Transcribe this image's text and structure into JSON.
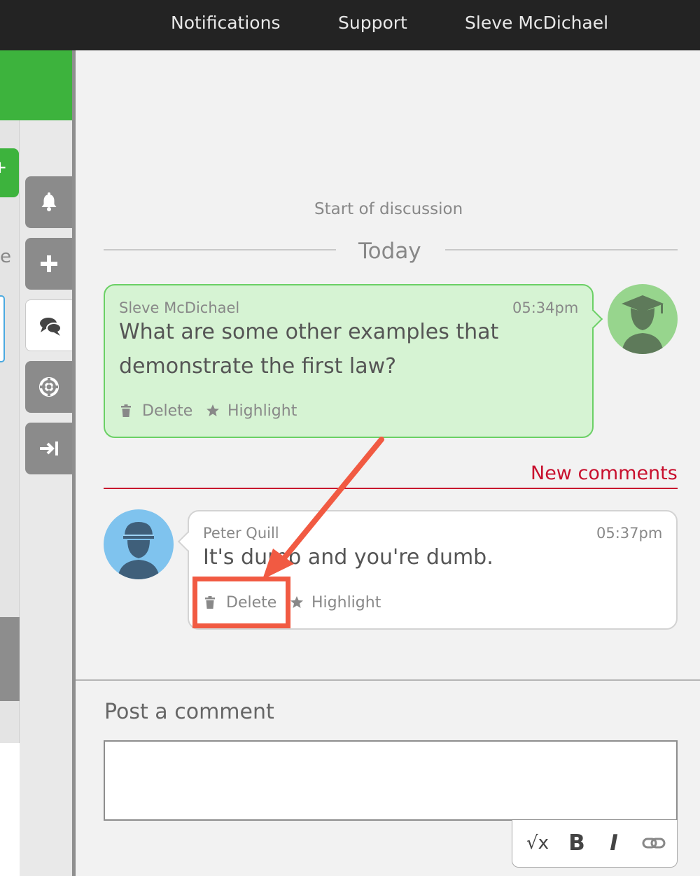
{
  "topnav": {
    "notifications": "Notifications",
    "support": "Support",
    "user": "Sleve McDichael"
  },
  "sidebar": {
    "green_button": "+",
    "cut_letter": "e",
    "tools": [
      {
        "name": "notifications",
        "icon": "bell-icon"
      },
      {
        "name": "add",
        "icon": "plus-icon"
      },
      {
        "name": "discussion",
        "icon": "chat-icon",
        "active": true
      },
      {
        "name": "help",
        "icon": "lifebuoy-icon"
      },
      {
        "name": "collapse",
        "icon": "collapse-right-icon"
      }
    ]
  },
  "discussion": {
    "start_label": "Start of discussion",
    "day_label": "Today",
    "new_comments_label": "New comments",
    "messages": [
      {
        "author": "Sleve McDichael",
        "time": "05:34pm",
        "text": "What are some other examples that demonstrate the first law?",
        "delete_label": "Delete",
        "highlight_label": "Highlight",
        "avatar": "graduate-avatar-icon"
      },
      {
        "author": "Peter Quill",
        "time": "05:37pm",
        "text": "It's dumb and you're dumb.",
        "delete_label": "Delete",
        "highlight_label": "Highlight",
        "avatar": "student-cap-avatar-icon"
      }
    ]
  },
  "post": {
    "title": "Post a comment",
    "placeholder": "",
    "toolbar": {
      "math": "√x",
      "bold": "B",
      "italic": "I",
      "link_icon": "link-icon"
    }
  },
  "annotation": {
    "color": "#f15a42",
    "target": "Delete"
  },
  "colors": {
    "topbar": "#232323",
    "accent_green": "#3db33d",
    "mine_bubble": "#d6f3d3",
    "new_comments_red": "#c8102e"
  }
}
